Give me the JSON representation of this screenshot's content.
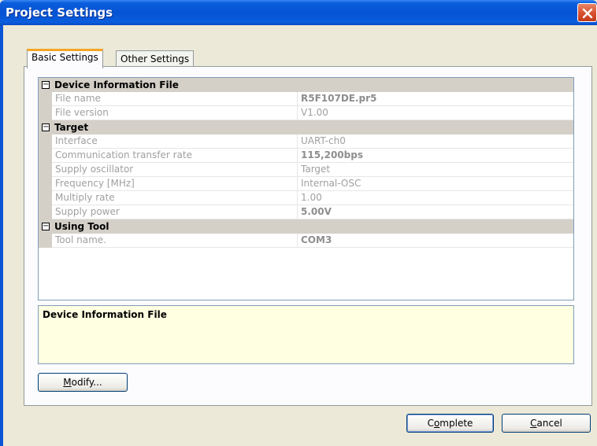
{
  "window": {
    "title": "Project Settings"
  },
  "tabs": [
    {
      "label": "Basic Settings",
      "active": true
    },
    {
      "label": "Other Settings",
      "active": false
    }
  ],
  "categories": [
    {
      "label": "Device Information File",
      "toggle": "⊟",
      "properties": [
        {
          "name": "File name",
          "value": "R5F107DE.pr5"
        },
        {
          "name": "File version",
          "value": "V1.00"
        }
      ]
    },
    {
      "label": "Target",
      "toggle": "⊟",
      "properties": [
        {
          "name": "Interface",
          "value": "UART-ch0"
        },
        {
          "name": "Communication transfer rate",
          "value": "115,200bps"
        },
        {
          "name": "Supply oscillator",
          "value": "Target"
        },
        {
          "name": "Frequency [MHz]",
          "value": "Internal-OSC"
        },
        {
          "name": "Multiply rate",
          "value": "1.00"
        },
        {
          "name": "Supply power",
          "value": "5.00V"
        }
      ]
    },
    {
      "label": "Using Tool",
      "toggle": "⊟",
      "properties": [
        {
          "name": "Tool name.",
          "value": "COM3"
        }
      ]
    }
  ],
  "description": {
    "title": "Device Information File"
  },
  "buttons": {
    "modify": {
      "label": "Modify...",
      "mnemonic": "M",
      "rest": "odify..."
    },
    "complete": {
      "label": "Complete",
      "mnemonic": "o",
      "pre": "C",
      "rest": "mplete"
    },
    "cancel": {
      "label": "Cancel",
      "mnemonic": "C",
      "rest": "ancel"
    }
  },
  "colors": {
    "titlebar": "#0553d4",
    "close_button": "#d8502f",
    "tab_highlight": "#f5a623",
    "category_row": "#d4d0c8",
    "description_background": "#ffffe1"
  }
}
